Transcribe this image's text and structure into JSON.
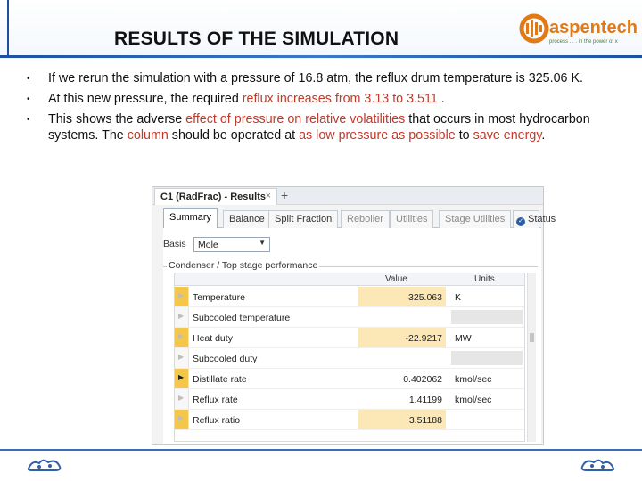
{
  "slide": {
    "title": "RESULTS OF THE SIMULATION",
    "logo": {
      "name": "aspentech",
      "tagline": "process . . . in the power of x"
    },
    "colors": {
      "accent_blue": "#1f4fa0",
      "logo_orange": "#e07a16",
      "highlight_red": "#c0392b"
    }
  },
  "bullets": [
    {
      "parts": [
        {
          "text": "If we rerun the simulation with a pressure of 16.8 atm, the reflux drum temperature is 325.06 K.",
          "red": false
        }
      ]
    },
    {
      "parts": [
        {
          "text": "At this new pressure, the required ",
          "red": false
        },
        {
          "text": "reflux increases from 3.13 to 3.511",
          "red": true
        },
        {
          "text": " .",
          "red": false
        }
      ]
    },
    {
      "parts": [
        {
          "text": "This shows the adverse ",
          "red": false
        },
        {
          "text": "effect of pressure on relative volatilities",
          "red": true
        },
        {
          "text": " that occurs in most hydrocarbon systems. The ",
          "red": false
        },
        {
          "text": "column",
          "red": true
        },
        {
          "text": " should be operated at ",
          "red": false
        },
        {
          "text": "as low pressure as possible",
          "red": true
        },
        {
          "text": " to ",
          "red": false
        },
        {
          "text": "save energy",
          "red": true
        },
        {
          "text": ".",
          "red": false
        }
      ]
    }
  ],
  "window": {
    "doc_tab": "C1 (RadFrac) - Results",
    "doc_tab_close": "×",
    "doc_tab_add": "+",
    "tabs": [
      "Summary",
      "Balance",
      "Split Fraction",
      "Reboiler",
      "Utilities",
      "Stage Utilities",
      "Status"
    ],
    "active_tab": "Summary",
    "basis_label": "Basis",
    "basis_value": "Mole",
    "group_title": "Condenser / Top stage performance",
    "columns": {
      "value": "Value",
      "units": "Units"
    },
    "rows": [
      {
        "name": "Temperature",
        "value": "325.063",
        "units": "K"
      },
      {
        "name": "Subcooled temperature",
        "value": "",
        "units": ""
      },
      {
        "name": "Heat duty",
        "value": "-22.9217",
        "units": "MW"
      },
      {
        "name": "Subcooled duty",
        "value": "",
        "units": ""
      },
      {
        "name": "Distillate rate",
        "value": "0.402062",
        "units": "kmol/sec"
      },
      {
        "name": "Reflux rate",
        "value": "1.41199",
        "units": "kmol/sec"
      },
      {
        "name": "Reflux ratio",
        "value": "3.51188",
        "units": ""
      }
    ]
  }
}
